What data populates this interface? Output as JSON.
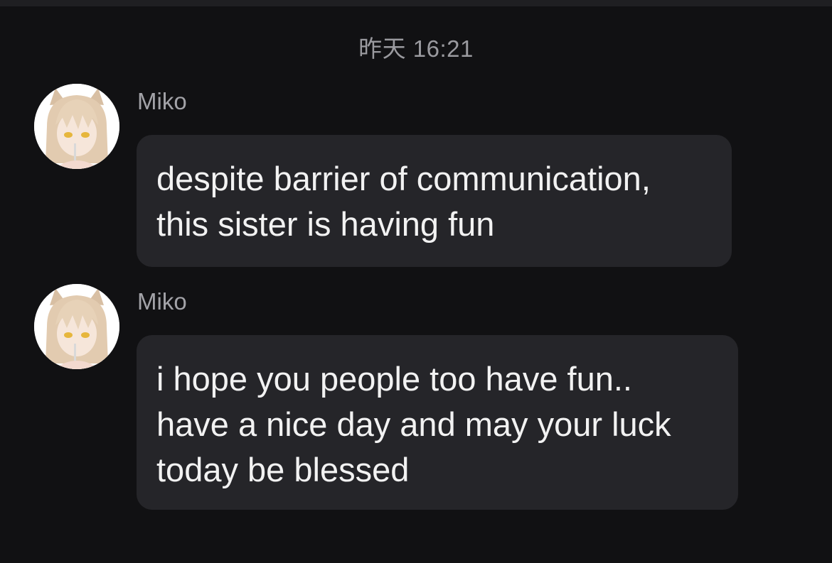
{
  "timestamp": "昨天 16:21",
  "messages": [
    {
      "sender": "Miko",
      "lines": [
        "despite barrier of communication,",
        "this sister is having fun"
      ]
    },
    {
      "sender": "Miko",
      "lines": [
        "i hope you people too have fun..",
        "have a nice day and may your luck",
        "today be blessed"
      ]
    }
  ],
  "colors": {
    "background": "#111113",
    "bubble": "#252529",
    "message_text": "#f2f2f2",
    "meta_text": "#a3a3a8"
  },
  "icons": {
    "avatar": "anime-girl-avatar"
  }
}
